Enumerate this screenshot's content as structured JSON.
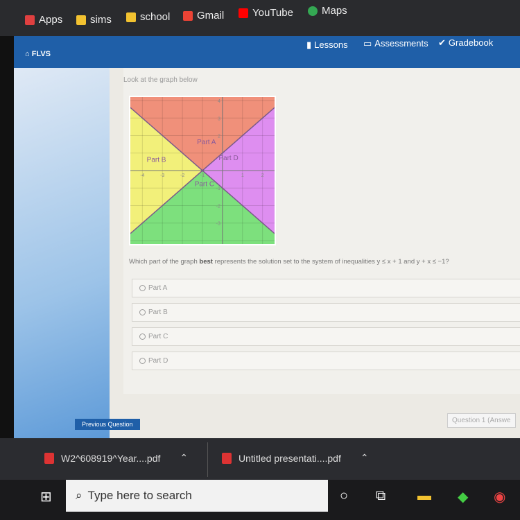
{
  "bookmarks": [
    {
      "label": "Apps",
      "color": "#e04040"
    },
    {
      "label": "sims",
      "color": "#f2c230"
    },
    {
      "label": "school",
      "color": "#f2c230"
    },
    {
      "label": "Gmail",
      "color": "#ea4335"
    },
    {
      "label": "YouTube",
      "color": "#ff0000"
    },
    {
      "label": "Maps",
      "color": "#34a853"
    }
  ],
  "nav": {
    "brand": "FLVS",
    "lessons": "Lessons",
    "assessments": "Assessments",
    "gradebook": "Gradebook"
  },
  "prompt": "Look at the graph below",
  "graph": {
    "x_ticks": [
      -4,
      -3,
      -2,
      -1,
      1,
      2
    ],
    "y_ticks": [
      4,
      3,
      2,
      -1,
      -2,
      -3
    ],
    "xlim": [
      -4.6,
      2.6
    ],
    "ylim": [
      -4.2,
      4.2
    ],
    "lines": [
      "y = x + 1",
      "y = -x - 1"
    ],
    "regions": [
      {
        "label": "Part A",
        "color": "#f0907a"
      },
      {
        "label": "Part B",
        "color": "#f2f07a"
      },
      {
        "label": "Part C",
        "color": "#7de07d"
      },
      {
        "label": "Part D",
        "color": "#de8ef0"
      }
    ]
  },
  "question": {
    "pre": "Which part of the graph ",
    "bold": "best",
    "post": " represents the solution set to the system of inequalities y ≤ x + 1 and y + x ≤ −1?"
  },
  "options": [
    "Part A",
    "Part B",
    "Part C",
    "Part D"
  ],
  "footer": {
    "previous": "Previous Question",
    "answered": "Question 1 (Answe"
  },
  "downloads": [
    "W2^608919^Year....pdf",
    "Untitled presentati....pdf"
  ],
  "taskbar": {
    "search_placeholder": "Type here to search"
  }
}
